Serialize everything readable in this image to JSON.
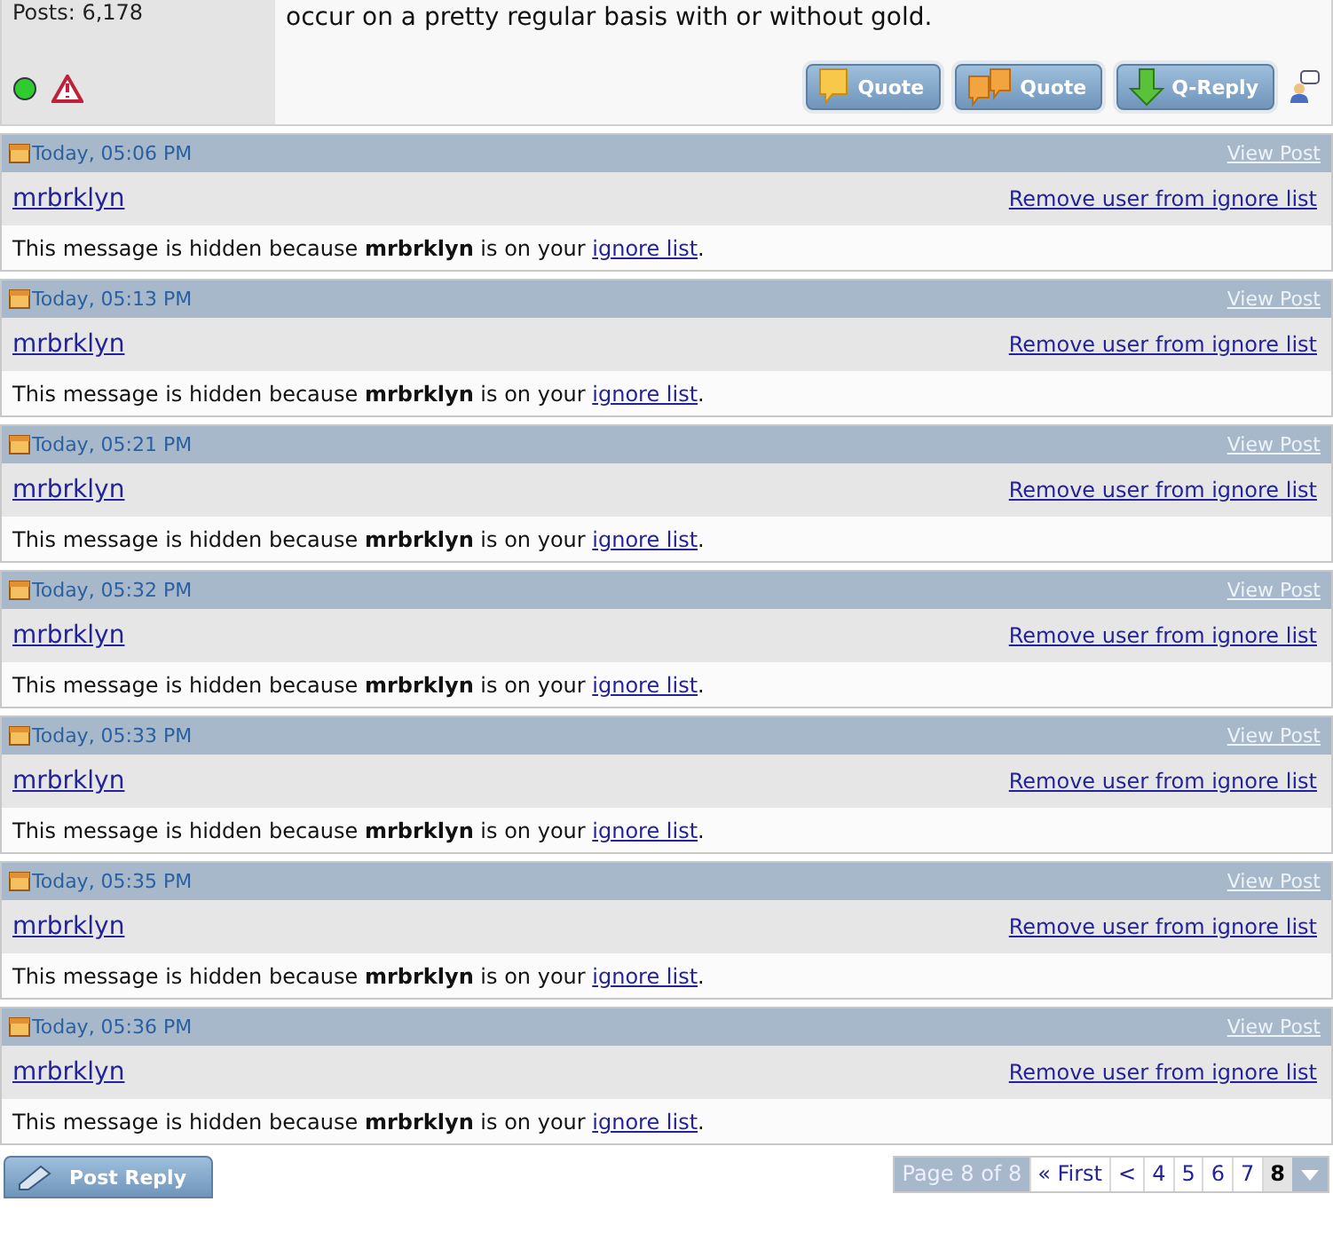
{
  "previous_post": {
    "posts_count": "Posts: 6,178",
    "online": true,
    "message": "occur on a pretty regular basis with or without gold.",
    "buttons": [
      {
        "kind": "quote",
        "label": "Quote"
      },
      {
        "kind": "multiquote",
        "label": "Quote"
      },
      {
        "kind": "reply",
        "label": "Q-Reply"
      }
    ]
  },
  "hidden_posts": [
    {
      "time": "Today, 05:06 PM",
      "view_link": "View Post",
      "user": "mrbrklyn",
      "remove_link": "Remove user from ignore list",
      "message": "This message is hidden because **mrbrklyn** is on your",
      "link": "ignore list",
      "suffix": "."
    },
    {
      "time": "Today, 05:13 PM",
      "view_link": "View Post",
      "user": "mrbrklyn",
      "remove_link": "Remove user from ignore list",
      "message": "This message is hidden because **mrbrklyn** is on your",
      "link": "ignore list",
      "suffix": "."
    },
    {
      "time": "Today, 05:21 PM",
      "view_link": "View Post",
      "user": "mrbrklyn",
      "remove_link": "Remove user from ignore list",
      "message": "This message is hidden because **mrbrklyn** is on your",
      "link": "ignore list",
      "suffix": "."
    },
    {
      "time": "Today, 05:32 PM",
      "view_link": "View Post",
      "user": "mrbrklyn",
      "remove_link": "Remove user from ignore list",
      "message": "This message is hidden because **mrbrklyn** is on your",
      "link": "ignore list",
      "suffix": "."
    },
    {
      "time": "Today, 05:33 PM",
      "view_link": "View Post",
      "user": "mrbrklyn",
      "remove_link": "Remove user from ignore list",
      "message": "This message is hidden because **mrbrklyn** is on your",
      "link": "ignore list",
      "suffix": "."
    },
    {
      "time": "Today, 05:35 PM",
      "view_link": "View Post",
      "user": "mrbrklyn",
      "remove_link": "Remove user from ignore list",
      "message": "This message is hidden because **mrbrklyn** is on your",
      "link": "ignore list",
      "suffix": "."
    },
    {
      "time": "Today, 05:36 PM",
      "view_link": "View Post",
      "user": "mrbrklyn",
      "remove_link": "Remove user from ignore list",
      "message": "This message is hidden because **mrbrklyn** is on your",
      "link": "ignore list",
      "suffix": "."
    }
  ],
  "post_reply_button": "Post Reply",
  "pagination": {
    "label": "Page 8 of 8",
    "first": "« First",
    "prev": "<",
    "pages": [
      {
        "label": "4",
        "selected": false
      },
      {
        "label": "5",
        "selected": false
      },
      {
        "label": "6",
        "selected": false
      },
      {
        "label": "7",
        "selected": false
      },
      {
        "label": "8",
        "selected": true
      }
    ]
  }
}
